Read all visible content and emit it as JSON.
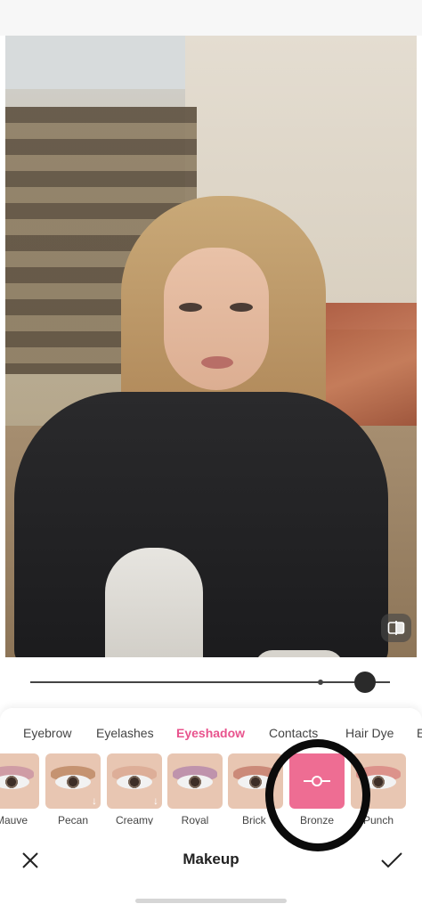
{
  "editor": {
    "compare_icon": "compare-icon",
    "intensity": 0.9
  },
  "tabs": [
    {
      "label": "Eyebrow",
      "active": false
    },
    {
      "label": "Eyelashes",
      "active": false
    },
    {
      "label": "Eyeshadow",
      "active": true
    },
    {
      "label": "Contacts",
      "active": false
    },
    {
      "label": "Hair Dye",
      "active": false
    }
  ],
  "swatches": [
    {
      "label": "Mauve",
      "color": "#b97a9b",
      "download": false
    },
    {
      "label": "Pecan",
      "color": "#a86a3d",
      "download": true
    },
    {
      "label": "Creamy",
      "color": "#d49b83",
      "download": true
    },
    {
      "label": "Royal",
      "color": "#9c6aa8",
      "download": false
    },
    {
      "label": "Brick",
      "color": "#b35a4a",
      "download": false
    },
    {
      "label": "Bronze",
      "color": "#ee6d93",
      "selected": true
    },
    {
      "label": "Punch",
      "color": "#d1686c",
      "download": false
    }
  ],
  "bottom_bar": {
    "title": "Makeup",
    "cancel_icon": "close-icon",
    "confirm_icon": "check-icon"
  },
  "colors": {
    "accent": "#e8538d",
    "selected_swatch": "#ee6d93"
  }
}
